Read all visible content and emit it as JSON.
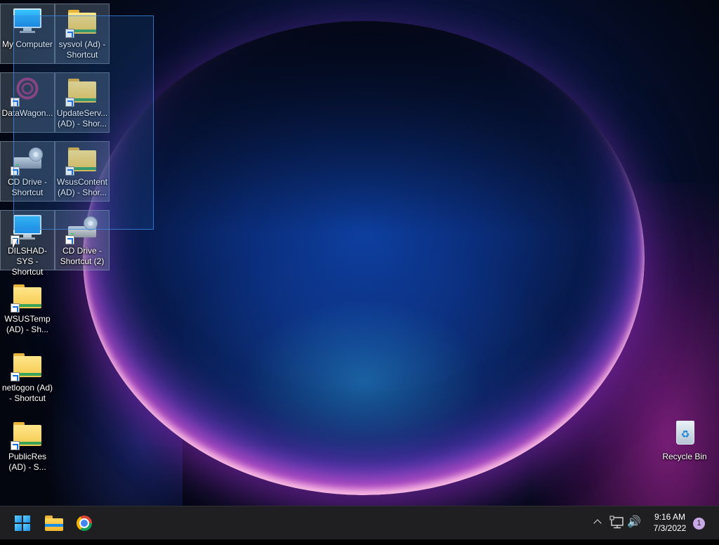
{
  "desktop": {
    "icons": [
      {
        "label": "My Computer"
      },
      {
        "label": "sysvol (Ad) - Shortcut"
      },
      {
        "label": "DataWagon..."
      },
      {
        "label": "UpdateServ... (AD) - Shor..."
      },
      {
        "label": "CD Drive - Shortcut"
      },
      {
        "label": "WsusContent (AD) - Shor..."
      },
      {
        "label": "DILSHAD-SYS - Shortcut"
      },
      {
        "label": "CD Drive - Shortcut (2)"
      },
      {
        "label": "WSUSTemp (AD) - Sh..."
      },
      {
        "label": "netlogon (Ad) - Shortcut"
      },
      {
        "label": "PublicRes (AD) - S..."
      },
      {
        "label": "Recycle Bin"
      }
    ]
  },
  "taskbar": {
    "clock_time": "9:16 AM",
    "clock_date": "7/3/2022",
    "notification_count": "1",
    "volume_glyph": "🔊"
  },
  "icons_semantic": [
    "windows-start-icon",
    "file-explorer-icon",
    "chrome-icon",
    "chevron-up-icon",
    "network-icon",
    "volume-icon"
  ],
  "colors": {
    "taskbar_bg": "#1f1f22",
    "selection": "#2e6ec8",
    "badge": "#c9a8e6"
  }
}
